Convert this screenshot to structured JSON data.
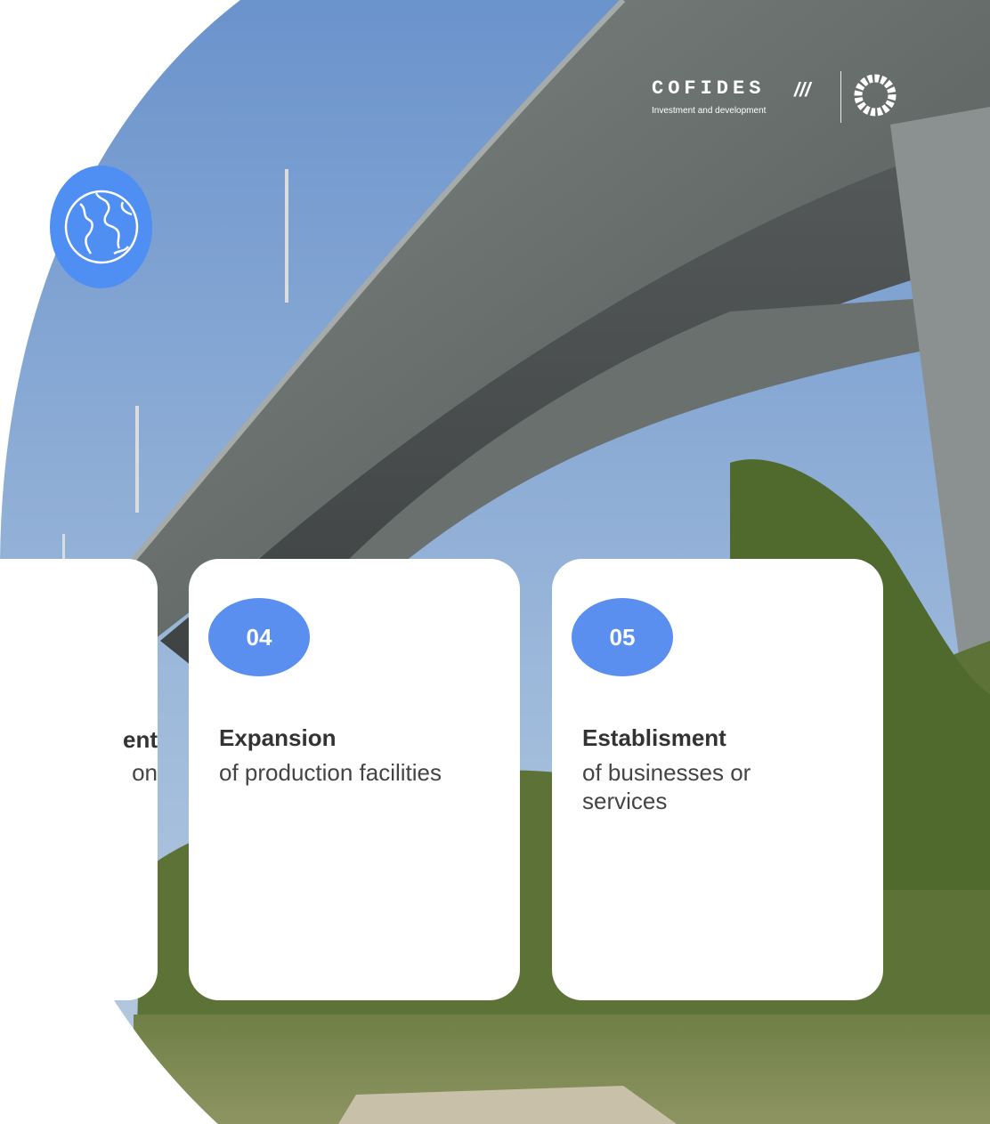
{
  "logo": {
    "wordmark": "COFIDES",
    "tagline": "Investment and development",
    "icon": "cofides-slashes-icon",
    "partner_icon": "ring-emblem-icon"
  },
  "globe_badge": {
    "icon": "globe-icon",
    "color": "#4f8ef2"
  },
  "cards": [
    {
      "title": "ent",
      "description": "on"
    },
    {
      "number": "04",
      "title": "Expansion",
      "description": "of production facilities"
    },
    {
      "number": "05",
      "title": "Establisment",
      "description": "of businesses or services"
    }
  ],
  "colors": {
    "accent": "#5a8ff0",
    "card_bg": "#ffffff"
  }
}
